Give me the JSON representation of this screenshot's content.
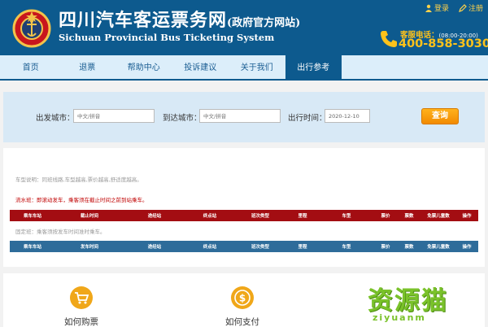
{
  "header": {
    "title": "四川汽车客运票务网",
    "title_suffix": "(政府官方网站)",
    "subtitle": "Sichuan Provincial Bus Ticketing System",
    "login_label": "登录",
    "register_label": "注册",
    "hotline_label": "客服电话：",
    "hotline_hours": "(08:00-20:00)",
    "hotline_number": "400-858-3030"
  },
  "nav": {
    "items": [
      "首页",
      "退票",
      "帮助中心",
      "投诉建议",
      "关于我们",
      "出行参考"
    ],
    "active_index": 5
  },
  "search": {
    "from_label": "出发城市：",
    "from_placeholder": "中文/拼音",
    "to_label": "到达城市：",
    "to_placeholder": "中文/拼音",
    "date_label": "出行时间：",
    "date_value": "2020-12-10",
    "query_label": "查询"
  },
  "results": {
    "note_general": "车型说明：同班线路,车型越高,票价越高,舒适度越高。",
    "note_rolling": "流水班：即滚动发车，乘客须在截止时间之前到站乘车。",
    "rolling_headers": [
      "乘车车站",
      "截止时间",
      "途经站",
      "终点站",
      "班次类型",
      "里程",
      "车型",
      "票价",
      "票数",
      "免票儿童数",
      "操作"
    ],
    "note_fixed": "固定班：乘客须按发车时间准时乘车。",
    "fixed_headers": [
      "乘车车站",
      "发车时间",
      "途经站",
      "终点站",
      "班次类型",
      "里程",
      "车型",
      "票价",
      "票数",
      "免票儿童数",
      "操作"
    ]
  },
  "help": {
    "buy_label": "如何购票",
    "pay_label": "如何支付"
  },
  "watermark": {
    "text": "资源猫",
    "sub": "ziyuanm"
  },
  "colors": {
    "header_bg": "#0d5a8e",
    "nav_bg": "#dceefa",
    "accent_orange": "#f28a00",
    "rolling_header_bg": "#a30d12",
    "fixed_header_bg": "#2e6c9a",
    "hotline_color": "#ffc21a"
  }
}
